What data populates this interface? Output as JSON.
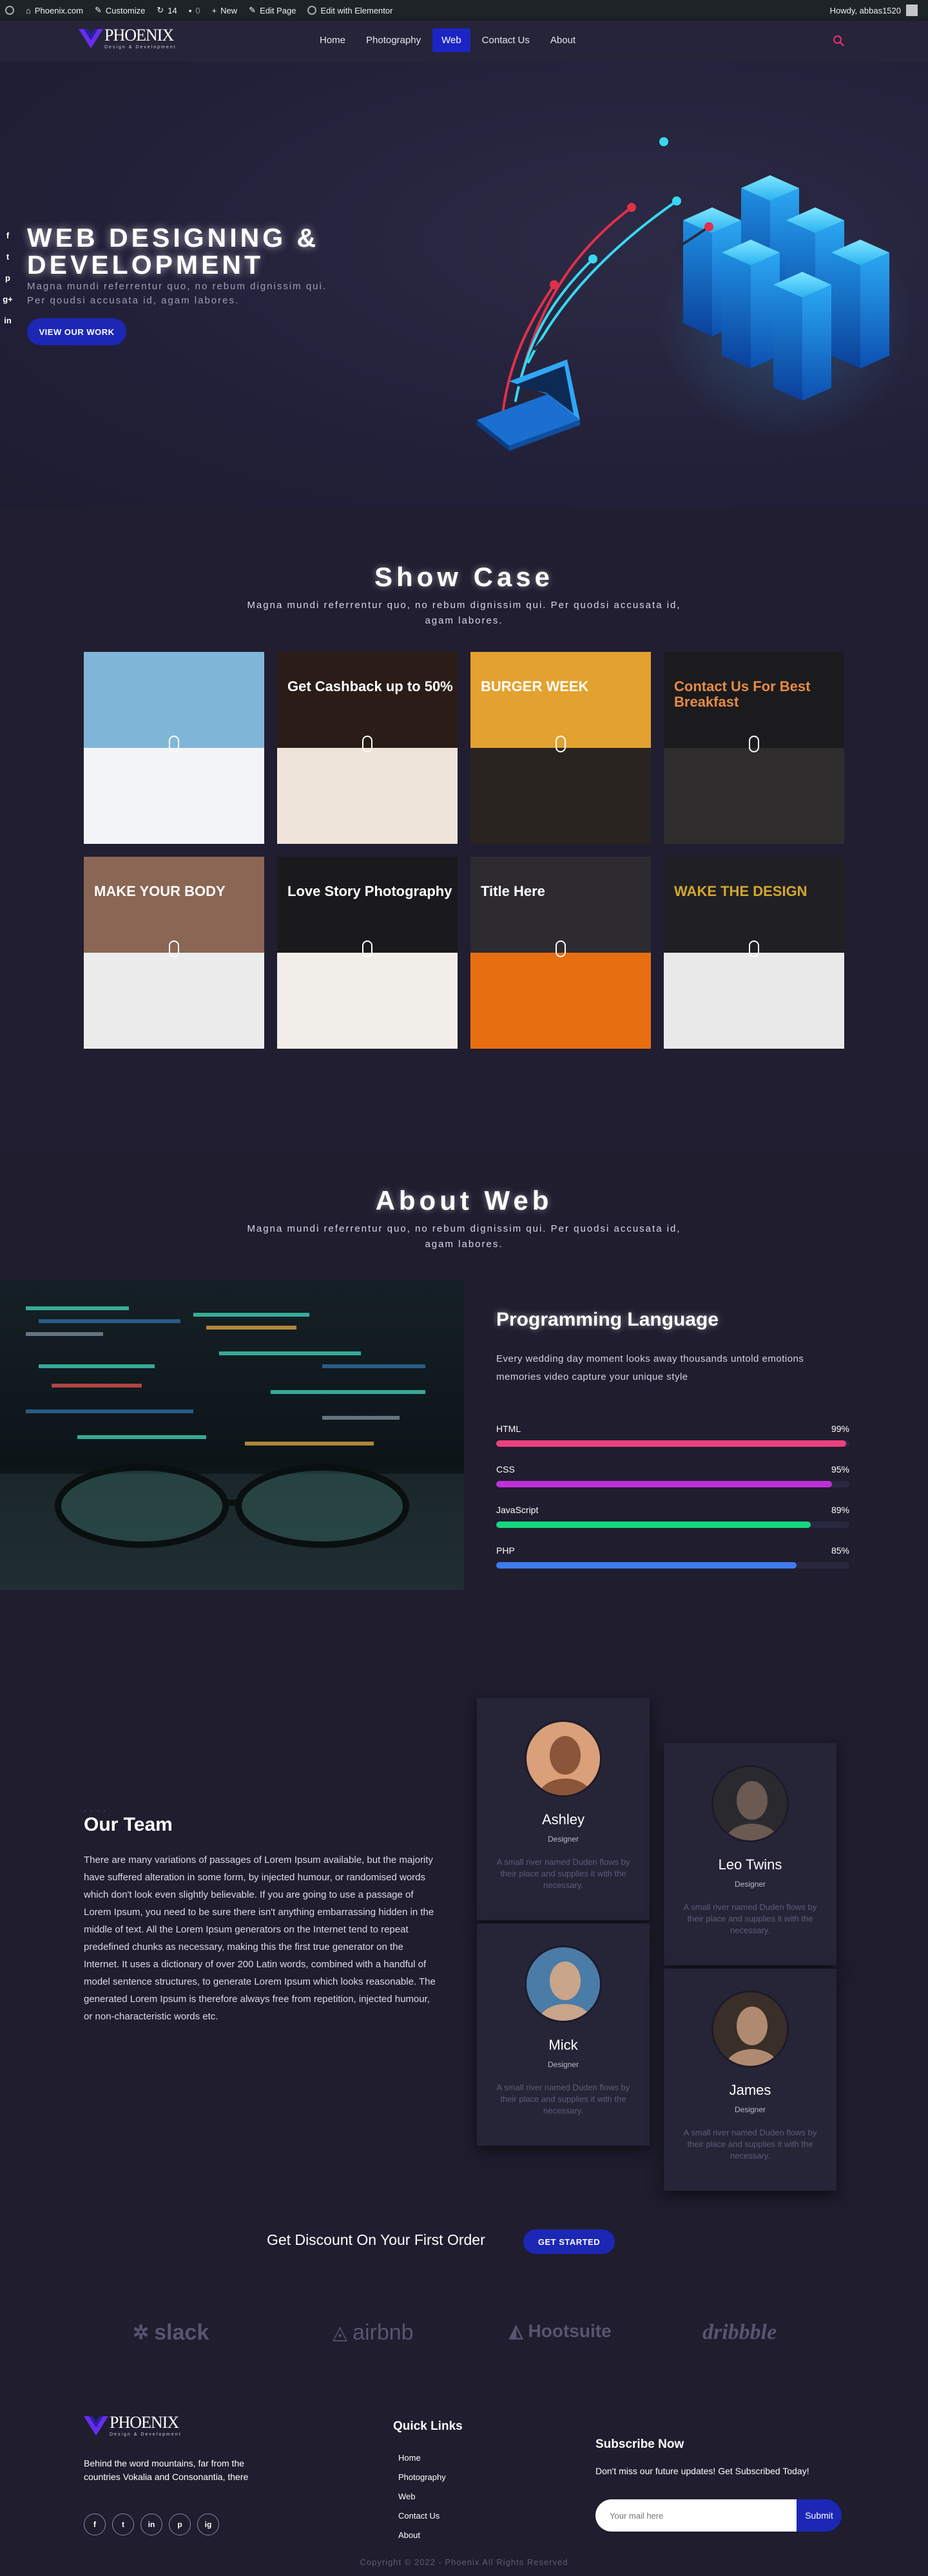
{
  "adminbar": {
    "site": "Phoenix.com",
    "customize": "Customize",
    "updates": "14",
    "comments": "0",
    "new": "New",
    "edit_page": "Edit Page",
    "elementor": "Edit with Elementor",
    "howdy": "Howdy, abbas1520"
  },
  "header": {
    "logo_big": "PHOENIX",
    "logo_small": "Design & Development",
    "nav": [
      "Home",
      "Photography",
      "Web",
      "Contact Us",
      "About"
    ],
    "active_nav": "Web",
    "search_icon": "search-icon"
  },
  "hero": {
    "title_line1": "WEB DESIGNING &",
    "title_line2": "DEVELOPMENT",
    "subtitle_line1": "Magna mundi referrentur quo, no rebum dignissim qui.",
    "subtitle_line2": "Per qoudsi accusata id, agam labores.",
    "cta": "VIEW OUR WORK",
    "social": [
      "f",
      "t",
      "p",
      "g+",
      "in"
    ]
  },
  "showcase": {
    "title": "Show Case",
    "subtitle": "Magna mundi referrentur quo, no rebum dignissim qui. Per quodsi accusata id, agam labores.",
    "tiles": [
      {
        "title": "",
        "top": "#7fb6d8",
        "bot": "#f2f4f7",
        "text_color": "#ffffff"
      },
      {
        "title": "Get Cashback up to 50%",
        "top": "#2a1d17",
        "bot": "#efe4da",
        "text_color": "#ffffff"
      },
      {
        "title": "BURGER WEEK",
        "top": "#e3a12f",
        "bot": "#2a2420",
        "text_color": "#ffffff"
      },
      {
        "title": "Contact Us For Best Breakfast",
        "top": "#1b1b1e",
        "bot": "#2e2c2d",
        "text_color": "#e68b45"
      },
      {
        "title": "MAKE YOUR BODY",
        "top": "#8a6654",
        "bot": "#ececec",
        "text_color": "#ffffff"
      },
      {
        "title": "Love Story Photography",
        "top": "#1a191c",
        "bot": "#f1eeea",
        "text_color": "#ffffff"
      },
      {
        "title": "Title Here",
        "top": "#2d2b30",
        "bot": "#e86e12",
        "text_color": "#ffffff"
      },
      {
        "title": "WAKE THE DESIGN",
        "top": "#202024",
        "bot": "#e9e9e9",
        "text_color": "#d4a72c"
      }
    ]
  },
  "about": {
    "title": "About Web",
    "subtitle": "Magna mundi referrentur quo, no rebum dignissim qui. Per quodsi accusata id, agam labores.",
    "prog_title": "Programming Language",
    "prog_desc": "Every wedding day moment looks away thousands untold emotions memories video capture your unique style",
    "skills": [
      {
        "name": "HTML",
        "pct": "99%",
        "value": 99,
        "color": "#ee3f7f"
      },
      {
        "name": "CSS",
        "pct": "95%",
        "value": 95,
        "color": "#c030d8"
      },
      {
        "name": "JavaScript",
        "pct": "89%",
        "value": 89,
        "color": "#16d67e"
      },
      {
        "name": "PHP",
        "pct": "85%",
        "value": 85,
        "color": "#3d7dee"
      }
    ]
  },
  "team": {
    "dash": "- - - -",
    "title": "Our Team",
    "text": "There are many variations of passages of Lorem Ipsum available, but the majority have suffered alteration in some form, by injected humour, or randomised words which don't look even slightly believable. If you are going to use a passage of Lorem Ipsum, you need to be sure there isn't anything embarrassing hidden in the middle of text. All the Lorem Ipsum generators on the Internet tend to repeat predefined chunks as necessary, making this the first true generator on the Internet. It uses a dictionary of over 200 Latin words, combined with a handful of model sentence structures, to generate Lorem Ipsum which looks reasonable. The generated Lorem Ipsum is therefore always free from repetition, injected humour, or non-characteristic words etc.",
    "members": [
      {
        "name": "Ashley",
        "role": "Designer",
        "desc": "A small river named Duden flows by their place and supplies it with the necessary."
      },
      {
        "name": "Leo Twins",
        "role": "Designer",
        "desc": "A small river named Duden flows by their place and supplies it with the necessary."
      },
      {
        "name": "Mick",
        "role": "Designer",
        "desc": "A small river named Duden flows by their place and supplies it with the necessary."
      },
      {
        "name": "James",
        "role": "Designer",
        "desc": "A small river named Duden flows by their place and supplies it with the necessary."
      }
    ]
  },
  "discount": {
    "text": "Get Discount On Your First Order",
    "button": "GET STARTED"
  },
  "brands": [
    "slack",
    "airbnb",
    "Hootsuite",
    "dribbble"
  ],
  "footer": {
    "about": "Behind the word mountains, far from the countries Vokalia and Consonantia, there",
    "social": [
      "f",
      "t",
      "in",
      "p",
      "ig"
    ],
    "quick_links_title": "Quick Links",
    "quick_links": [
      "Home",
      "Photography",
      "Web",
      "Contact Us",
      "About"
    ],
    "subscribe_title": "Subscribe Now",
    "subscribe_desc": "Don't miss our future updates! Get Subscribed Today!",
    "email_placeholder": "Your mail here",
    "submit": "Submit",
    "copyright": "Copyright © 2022 - Phoenix All Rights Reserved"
  }
}
